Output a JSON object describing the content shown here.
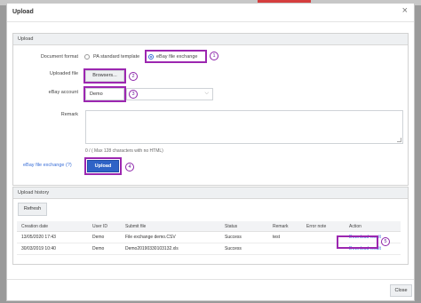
{
  "dialog": {
    "title": "Upload",
    "close_glyph": "×",
    "close_label": "Close"
  },
  "upload_panel": {
    "title": "Upload",
    "document_format_label": "Document format",
    "format_options": [
      "PA standard template",
      "eBay file exchange"
    ],
    "selected_format": "eBay file exchange",
    "uploaded_file_label": "Uploaded file",
    "browse_label": "Browsers...",
    "ebay_account_label": "eBay account",
    "ebay_account_value": "Demo",
    "remark_label": "Remark",
    "remark_value": "",
    "remark_hint": "0 / ( Max 128 characters with no HTML)",
    "help_link": "eBay file exchange (?)",
    "upload_button": "Upload"
  },
  "history_panel": {
    "title": "Upload history",
    "refresh_label": "Refresh",
    "columns": [
      "Creation date",
      "User ID",
      "Submit file",
      "Status",
      "Remark",
      "Error note",
      "Action"
    ],
    "rows": [
      {
        "creation_date": "13/05/2020 17:43",
        "user_id": "Demo",
        "submit_file": "File exchange demo.CSV",
        "status": "Success",
        "remark": "test",
        "error_note": "",
        "action": "Download result"
      },
      {
        "creation_date": "30/03/2019 10:40",
        "user_id": "Demo",
        "submit_file": "Demo20190330103132.xls",
        "status": "Success",
        "remark": "",
        "error_note": "",
        "action": "Download result"
      }
    ]
  },
  "annotations": [
    "1",
    "2",
    "3",
    "4",
    "5"
  ],
  "colors": {
    "accent": "#2f63c6",
    "highlight": "#9c27b0",
    "link": "#3a6fd8",
    "panel_header": "#eef0f2"
  },
  "icons": {
    "close": "close-icon",
    "dropdown": "chevron-down-icon"
  }
}
